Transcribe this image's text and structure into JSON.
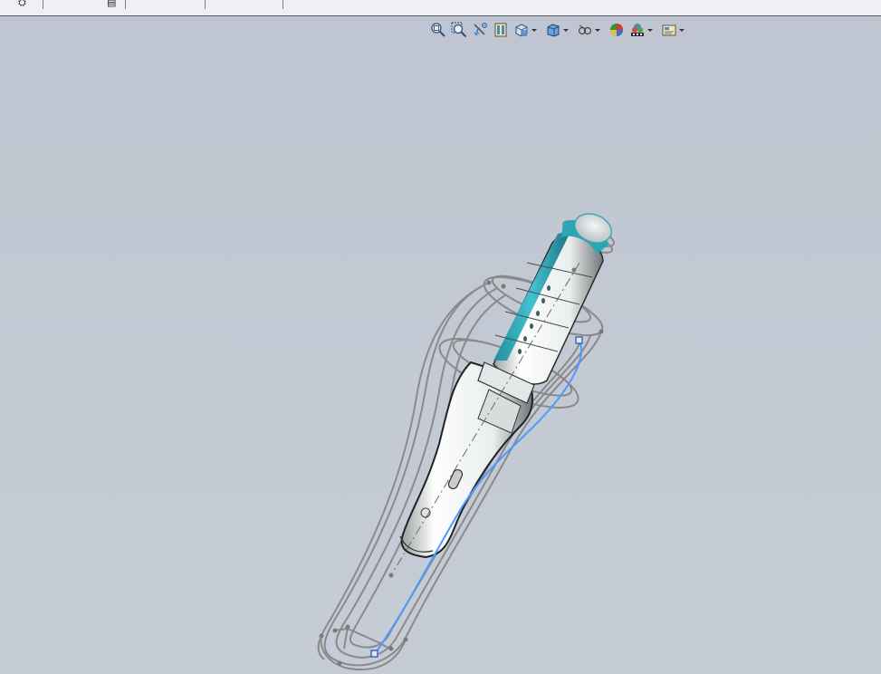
{
  "colors": {
    "background": "#c3c9d3",
    "sketch_line": "#8a8a8a",
    "selected_curve": "#4b9bff",
    "accent_teal": "#2aa7b5",
    "body_white": "#f4f6f6"
  },
  "tab_strip": {
    "tabs": [
      "tab-1",
      "tab-2",
      "tab-3",
      "tab-4"
    ]
  },
  "toolbar": {
    "buttons": [
      {
        "icon": "zoom-to-fit-icon"
      },
      {
        "icon": "zoom-to-area-icon"
      },
      {
        "icon": "previous-view-icon"
      },
      {
        "icon": "section-view-icon"
      },
      {
        "icon": "view-orientation-icon",
        "dropdown": true
      },
      {
        "icon": "display-style-icon",
        "dropdown": true
      },
      {
        "icon": "hide-show-items-icon",
        "dropdown": true
      },
      {
        "icon": "edit-appearance-icon"
      },
      {
        "icon": "apply-scene-icon",
        "dropdown": true
      },
      {
        "icon": "view-settings-icon",
        "dropdown": true
      }
    ]
  },
  "model": {
    "name": "handheld-device-model"
  }
}
